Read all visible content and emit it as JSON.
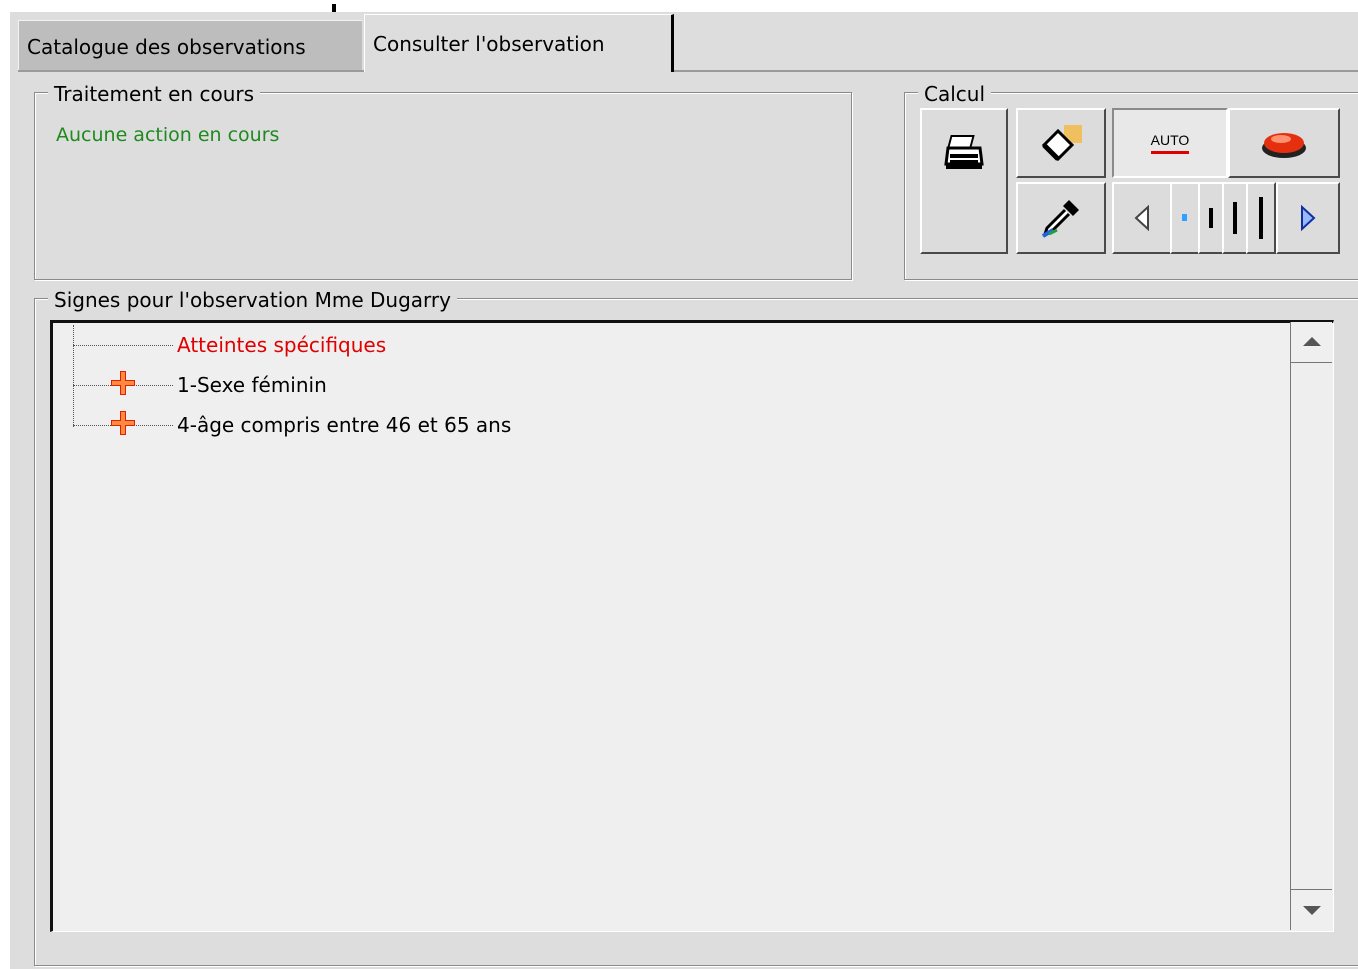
{
  "tabs": {
    "catalogue": "Catalogue des observations",
    "consulter": "Consulter l'observation"
  },
  "traitement": {
    "legend": "Traitement en cours",
    "status": "Aucune action en cours"
  },
  "calcul": {
    "legend": "Calcul",
    "buttons": {
      "print": "printer-icon",
      "erase": "eraser-icon",
      "auto": "AUTO",
      "stop": "red-stop-button-icon",
      "pipette": "eyedropper-icon",
      "step_prev": "step-back-icon",
      "step_next": "step-forward-icon"
    }
  },
  "signes": {
    "legend": "Signes pour l'observation Mme Dugarry",
    "items": [
      {
        "label": "Atteintes spécifiques",
        "color": "#e00000"
      },
      {
        "label": "1-Sexe féminin",
        "color": "#000000"
      },
      {
        "label": "4-âge compris entre 46 et 65 ans",
        "color": "#000000"
      }
    ]
  }
}
